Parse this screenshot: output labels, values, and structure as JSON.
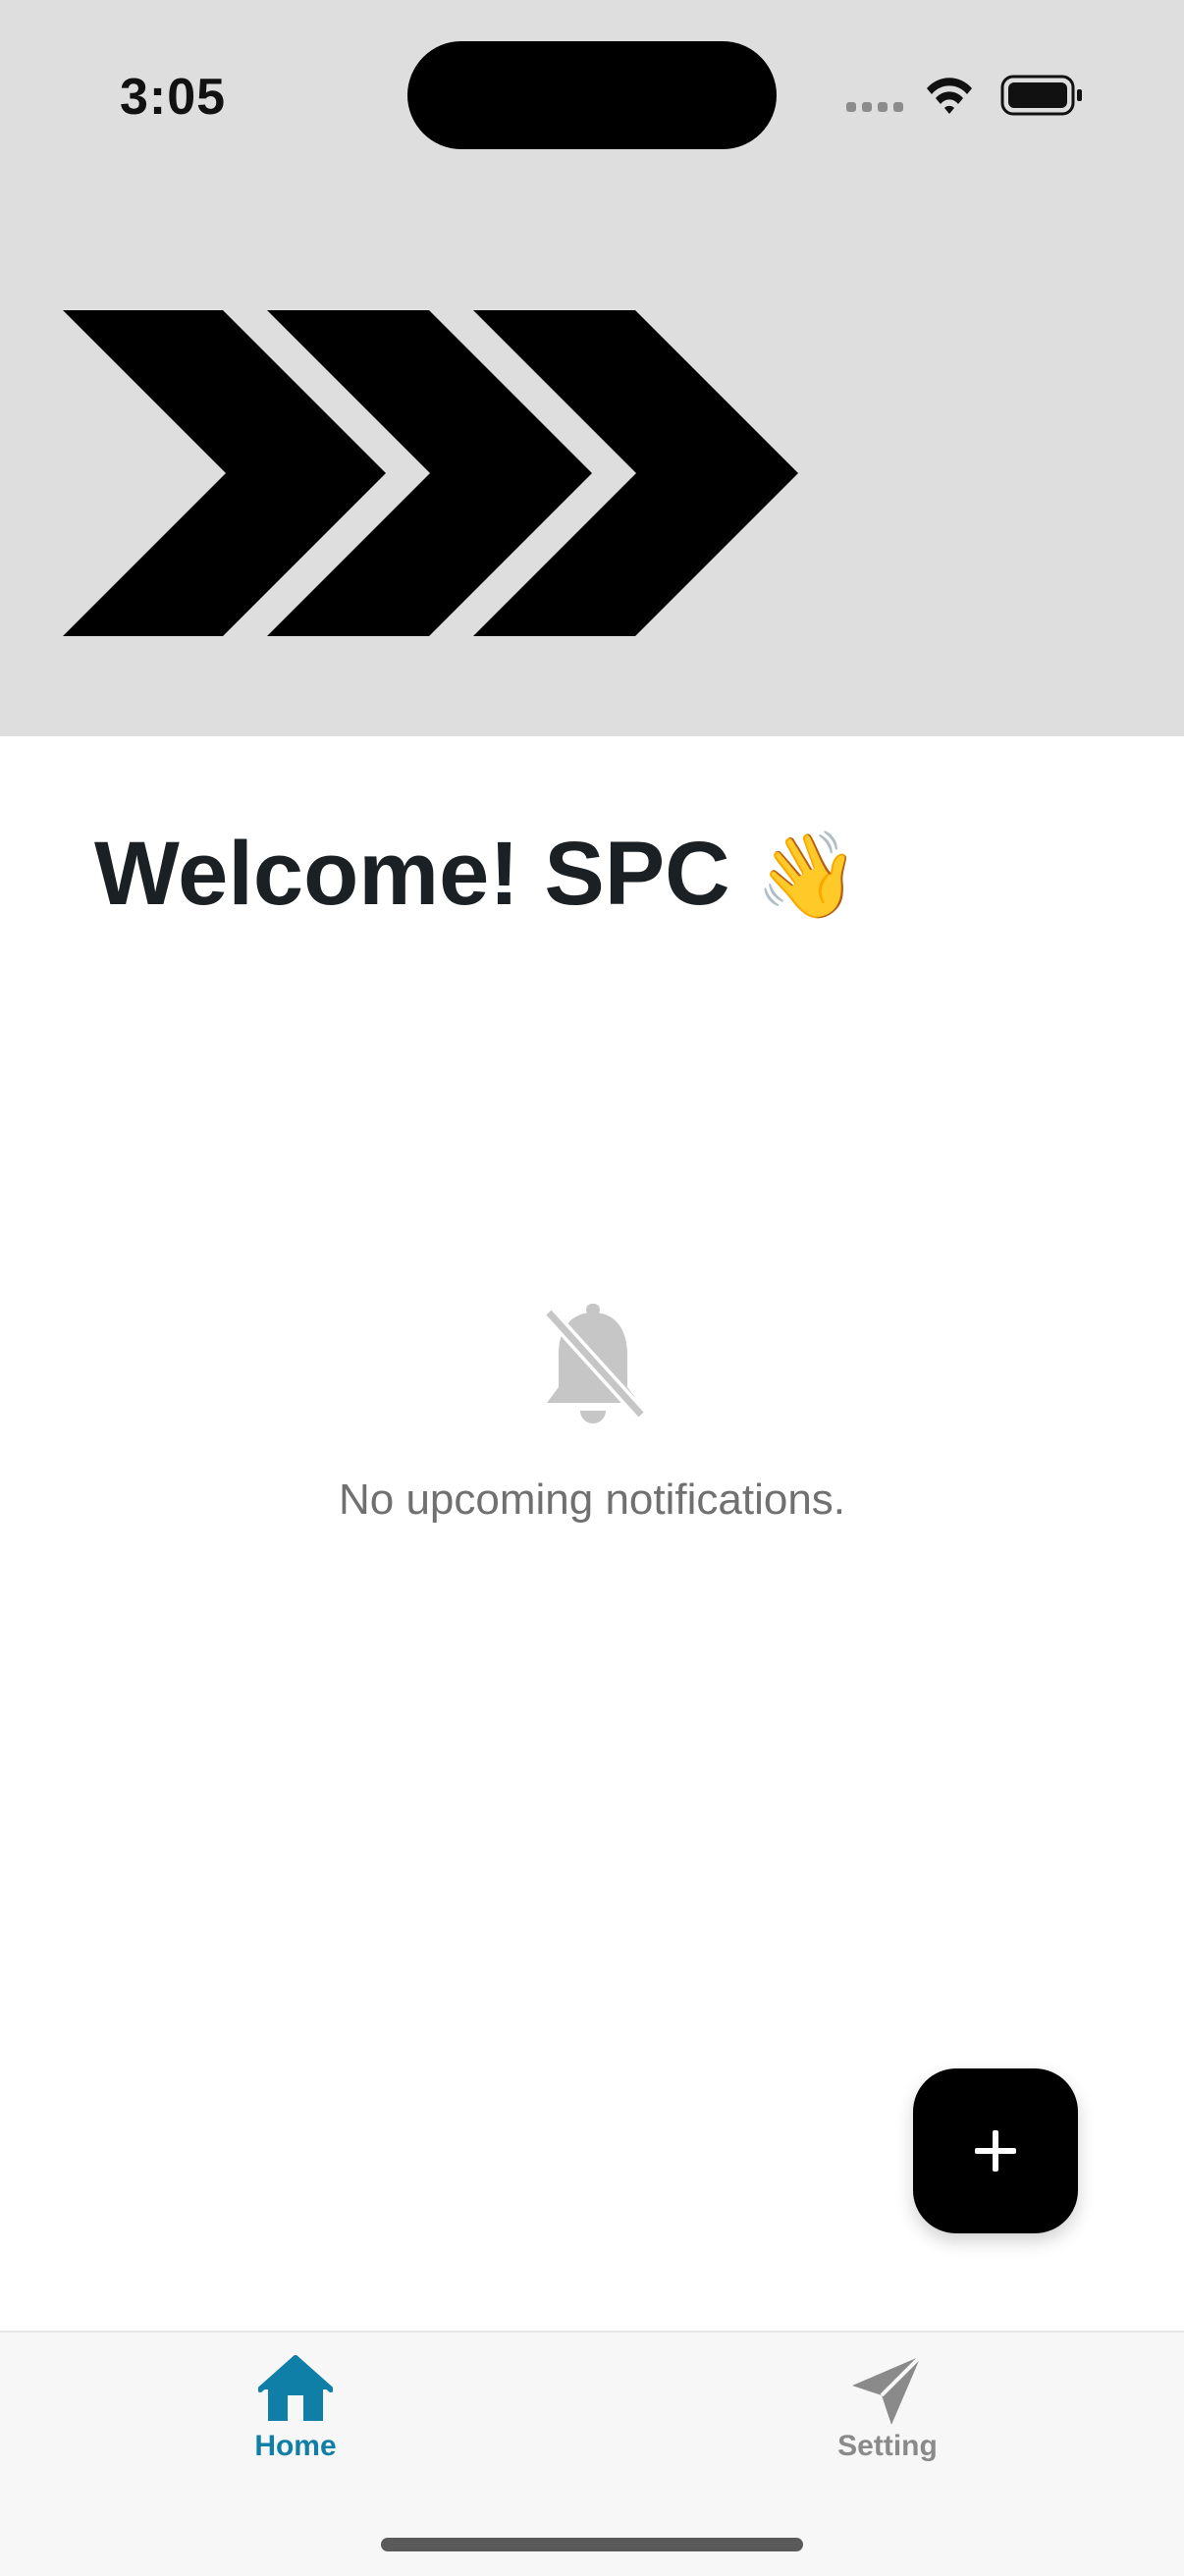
{
  "status_bar": {
    "time": "3:05"
  },
  "header": {
    "background": "#dedede",
    "logo_icon": "triple-chevron-logo"
  },
  "welcome": {
    "title": "Welcome! SPC",
    "emoji": "👋"
  },
  "empty_state": {
    "icon": "bell-off-icon",
    "message": "No upcoming notifications."
  },
  "fab": {
    "icon": "plus-icon"
  },
  "tabbar": {
    "active_color": "#0f7fa8",
    "inactive_color": "#8a8a8a",
    "tabs": [
      {
        "label": "Home",
        "icon": "home-icon",
        "active": true
      },
      {
        "label": "Setting",
        "icon": "send-icon",
        "active": false
      }
    ]
  }
}
